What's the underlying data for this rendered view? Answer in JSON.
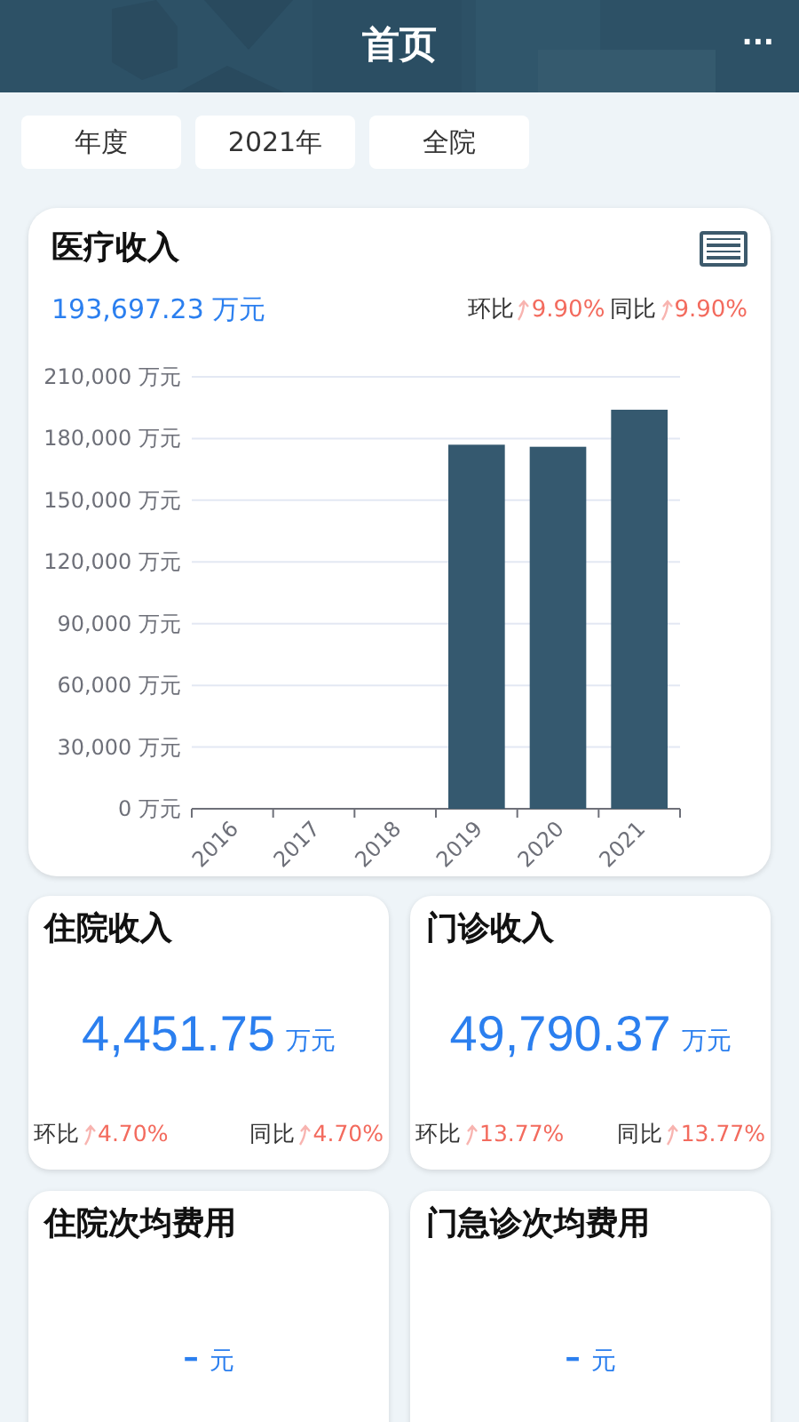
{
  "header": {
    "title": "首页",
    "more": "···"
  },
  "filters": [
    {
      "label": "年度"
    },
    {
      "label": "2021年"
    },
    {
      "label": "全院"
    }
  ],
  "main_card": {
    "title": "医疗收入",
    "value": "193,697.23",
    "unit": "万元",
    "comparisons": [
      {
        "label": "环比",
        "value": "9.90%",
        "up": true
      },
      {
        "label": "同比",
        "value": "9.90%",
        "up": true
      }
    ],
    "chart_data": {
      "type": "bar",
      "categories": [
        "2016",
        "2017",
        "2018",
        "2019",
        "2020",
        "2021"
      ],
      "series": [
        {
          "color": "#35596f",
          "values": [
            0,
            0,
            0,
            177000,
            176000,
            194000
          ]
        }
      ],
      "grid": true,
      "ylim": [
        0,
        210000
      ],
      "yticks": [
        {
          "value": 0,
          "label": "0 万元"
        },
        {
          "value": 30000,
          "label": "30,000 万元"
        },
        {
          "value": 60000,
          "label": "60,000 万元"
        },
        {
          "value": 90000,
          "label": "90,000 万元"
        },
        {
          "value": 120000,
          "label": "120,000 万元"
        },
        {
          "value": 150000,
          "label": "150,000 万元"
        },
        {
          "value": 180000,
          "label": "180,000 万元"
        },
        {
          "value": 210000,
          "label": "210,000 万元"
        }
      ]
    }
  },
  "stat_cards": [
    {
      "title": "住院收入",
      "value": "4,451.75",
      "unit": "万元",
      "comparisons": [
        {
          "label": "环比",
          "value": "4.70%",
          "up": true
        },
        {
          "label": "同比",
          "value": "4.70%",
          "up": true
        }
      ]
    },
    {
      "title": "门诊收入",
      "value": "49,790.37",
      "unit": "万元",
      "comparisons": [
        {
          "label": "环比",
          "value": "13.77%",
          "up": true
        },
        {
          "label": "同比",
          "value": "13.77%",
          "up": true
        }
      ]
    },
    {
      "title": "住院次均费用",
      "value": "-",
      "unit": "元"
    },
    {
      "title": "门急诊次均费用",
      "value": "-",
      "unit": "元"
    }
  ]
}
